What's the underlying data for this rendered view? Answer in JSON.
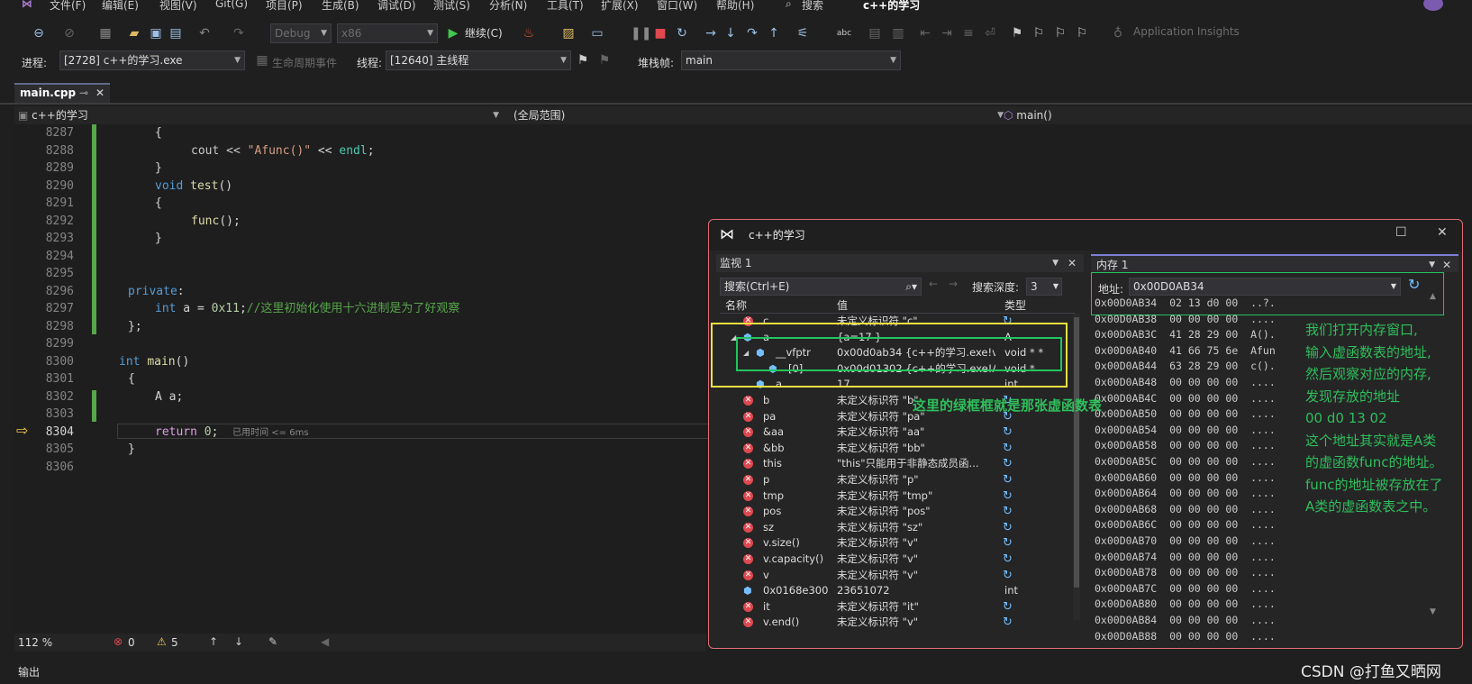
{
  "menu": [
    "文件(F)",
    "编辑(E)",
    "视图(V)",
    "Git(G)",
    "项目(P)",
    "生成(B)",
    "调试(D)",
    "测试(S)",
    "分析(N)",
    "工具(T)",
    "扩展(X)",
    "窗口(W)",
    "帮助(H)"
  ],
  "search_label": "搜索",
  "window_title": "c++的学习",
  "toolbar": {
    "config": "Debug",
    "platform": "x86",
    "continue_label": "继续(C)",
    "app_insights": "Application Insights"
  },
  "process": {
    "label": "进程:",
    "value": "[2728] c++的学习.exe",
    "lifecycle": "生命周期事件",
    "thread_label": "线程:",
    "thread_value": "[12640] 主线程",
    "stack_label": "堆栈帧:",
    "stack_value": "main"
  },
  "tab": {
    "name": "main.cpp"
  },
  "nav": {
    "project": "c++的学习",
    "scope": "(全局范围)",
    "func": "main()"
  },
  "code_lines": [
    {
      "ln": "8287"
    },
    {
      "ln": "8288"
    },
    {
      "ln": "8289"
    },
    {
      "ln": "8290"
    },
    {
      "ln": "8291"
    },
    {
      "ln": "8292"
    },
    {
      "ln": "8293"
    },
    {
      "ln": "8294"
    },
    {
      "ln": "8295"
    },
    {
      "ln": "8296"
    },
    {
      "ln": "8297"
    },
    {
      "ln": "8298"
    },
    {
      "ln": "8299"
    },
    {
      "ln": "8300"
    },
    {
      "ln": "8301"
    },
    {
      "ln": "8302"
    },
    {
      "ln": "8303"
    },
    {
      "ln": "8304"
    },
    {
      "ln": "8305"
    },
    {
      "ln": "8306"
    }
  ],
  "code": {
    "c8288a": "cout << ",
    "c8288b": "\"Afunc()\"",
    "c8288c": " << ",
    "c8288d": "endl",
    "c8290a": "void",
    "c8290b": "test",
    "c8292": "func",
    "c8296": "private",
    "c8297a": "int",
    "c8297b": " a = ",
    "c8297c": "0x11",
    "c8297d": "//这里初始化使用十六进制是为了好观察",
    "c8300a": "int",
    "c8300b": "main",
    "c8302": "A a;",
    "c8304a": "return",
    "c8304b": "0",
    "elapsed": "已用时间 <= 6ms"
  },
  "debug_window": {
    "title": "c++的学习"
  },
  "watch": {
    "title": "监视 1",
    "search_placeholder": "搜索(Ctrl+E)",
    "depth_label": "搜索深度:",
    "depth": "3",
    "col_name": "名称",
    "col_value": "值",
    "col_type": "类型",
    "rows": [
      {
        "name": "c",
        "value": "未定义标识符 \"c\"",
        "type": ""
      },
      {
        "name": "a",
        "value": "{a=17 }",
        "type": "A"
      },
      {
        "name": "__vfptr",
        "value": "0x00d0ab34 {c++的学习.exe!voi...",
        "type": "void * *"
      },
      {
        "name": "[0]",
        "value": "0x00d01302 {c++的学习.exe!A::f...",
        "type": "void *"
      },
      {
        "name": "a",
        "value": "17",
        "type": "int"
      },
      {
        "name": "b",
        "value": "未定义标识符 \"b\"",
        "type": ""
      },
      {
        "name": "pa",
        "value": "未定义标识符 \"pa\"",
        "type": ""
      },
      {
        "name": "&aa",
        "value": "未定义标识符 \"aa\"",
        "type": ""
      },
      {
        "name": "&bb",
        "value": "未定义标识符 \"bb\"",
        "type": ""
      },
      {
        "name": "this",
        "value": "\"this\"只能用于非静态成员函...",
        "type": ""
      },
      {
        "name": "p",
        "value": "未定义标识符 \"p\"",
        "type": ""
      },
      {
        "name": "tmp",
        "value": "未定义标识符 \"tmp\"",
        "type": ""
      },
      {
        "name": "pos",
        "value": "未定义标识符 \"pos\"",
        "type": ""
      },
      {
        "name": "sz",
        "value": "未定义标识符 \"sz\"",
        "type": ""
      },
      {
        "name": "v.size()",
        "value": "未定义标识符 \"v\"",
        "type": ""
      },
      {
        "name": "v.capacity()",
        "value": "未定义标识符 \"v\"",
        "type": ""
      },
      {
        "name": "v",
        "value": "未定义标识符 \"v\"",
        "type": ""
      },
      {
        "name": "0x0168e300",
        "value": "23651072",
        "type": "int"
      },
      {
        "name": "it",
        "value": "未定义标识符 \"it\"",
        "type": ""
      },
      {
        "name": "v.end()",
        "value": "未定义标识符 \"v\"",
        "type": ""
      }
    ]
  },
  "memory": {
    "title": "内存 1",
    "addr_label": "地址:",
    "addr": "0x00D0AB34",
    "rows": [
      "0x00D0AB34  02 13 d0 00  ..?.",
      "0x00D0AB38  00 00 00 00  ....",
      "0x00D0AB3C  41 28 29 00  A().",
      "0x00D0AB40  41 66 75 6e  Afun",
      "0x00D0AB44  63 28 29 00  c().",
      "0x00D0AB48  00 00 00 00  ....",
      "0x00D0AB4C  00 00 00 00  ....",
      "0x00D0AB50  00 00 00 00  ....",
      "0x00D0AB54  00 00 00 00  ....",
      "0x00D0AB58  00 00 00 00  ....",
      "0x00D0AB5C  00 00 00 00  ....",
      "0x00D0AB60  00 00 00 00  ....",
      "0x00D0AB64  00 00 00 00  ....",
      "0x00D0AB68  00 00 00 00  ....",
      "0x00D0AB6C  00 00 00 00  ....",
      "0x00D0AB70  00 00 00 00  ....",
      "0x00D0AB74  00 00 00 00  ....",
      "0x00D0AB78  00 00 00 00  ....",
      "0x00D0AB7C  00 00 00 00  ....",
      "0x00D0AB80  00 00 00 00  ....",
      "0x00D0AB84  00 00 00 00  ....",
      "0x00D0AB88  00 00 00 00  ...."
    ]
  },
  "annotations": {
    "green_box_note": "这里的绿框框就是那张虚函数表",
    "mem_note": [
      "我们打开内存窗口,",
      "输入虚函数表的地址,",
      "然后观察对应的内存,",
      "发现存放的地址",
      "00 d0 13 02",
      "这个地址其实就是A类",
      "的虚函数func的地址。",
      "func的地址被存放在了",
      "A类的虚函数表之中。"
    ]
  },
  "status": {
    "zoom": "112 %",
    "errors": "0",
    "warnings": "5",
    "output_label": "输出",
    "watermark": "CSDN @打鱼又晒网"
  },
  "colors": {
    "annot_green": "#2fbf5b",
    "yellow_box": "#f0e040",
    "green_box": "#22c55e",
    "pink_border": "#e06c75"
  }
}
